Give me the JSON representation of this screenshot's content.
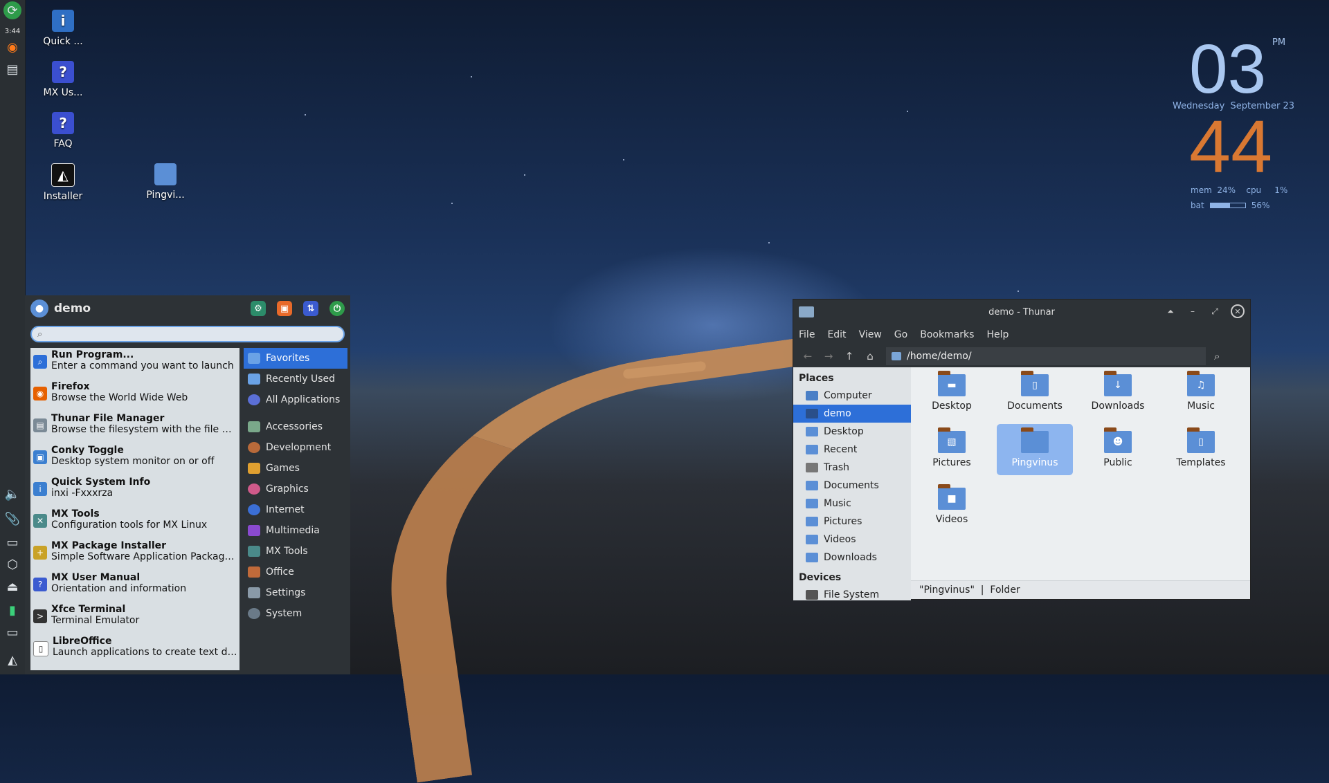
{
  "panel": {
    "clock": "3:44"
  },
  "desktop": {
    "icons": [
      {
        "label": "Quick ...",
        "icon": "info-monitor-icon"
      },
      {
        "label": "MX Us...",
        "icon": "help-icon"
      },
      {
        "label": "FAQ",
        "icon": "help-icon"
      },
      {
        "label": "Installer",
        "icon": "installer-icon"
      },
      {
        "label": "Pingvi...",
        "icon": "folder-icon"
      }
    ]
  },
  "conky": {
    "hour": "03",
    "ampm": "PM",
    "day": "Wednesday",
    "date": "September 23",
    "minute": "44",
    "mem_label": "mem",
    "mem": "24%",
    "cpu_label": "cpu",
    "cpu": "1%",
    "bat_label": "bat",
    "bat": "56%",
    "bat_level": 0.56
  },
  "menu": {
    "user": "demo",
    "search_value": "",
    "apps": [
      {
        "name": "Run Program...",
        "desc": "Enter a command you want to launch",
        "color": "#2d6fd8",
        "glyph": "⌕"
      },
      {
        "name": "Firefox",
        "desc": "Browse the World Wide Web",
        "color": "#e66000",
        "glyph": "◉"
      },
      {
        "name": "Thunar File Manager",
        "desc": "Browse the filesystem with the file ma...",
        "color": "#7b8a96",
        "glyph": "▤"
      },
      {
        "name": "Conky Toggle",
        "desc": "Desktop system monitor on or off",
        "color": "#3b7fd0",
        "glyph": "▣"
      },
      {
        "name": "Quick System Info",
        "desc": "inxi -Fxxxrza",
        "color": "#3b7fd0",
        "glyph": "i"
      },
      {
        "name": "MX Tools",
        "desc": "Configuration tools for MX Linux",
        "color": "#4a8a8a",
        "glyph": "✕"
      },
      {
        "name": "MX Package Installer",
        "desc": "Simple Software Application Package I...",
        "color": "#c9a227",
        "glyph": "+"
      },
      {
        "name": "MX User Manual",
        "desc": "Orientation and information",
        "color": "#3b5bd0",
        "glyph": "?"
      },
      {
        "name": "Xfce Terminal",
        "desc": "Terminal Emulator",
        "color": "#333333",
        "glyph": ">"
      },
      {
        "name": "LibreOffice",
        "desc": "Launch applications to create text doc...",
        "color": "#ffffff",
        "glyph": "▯"
      }
    ],
    "categories_top": [
      "Favorites",
      "Recently Used",
      "All Applications"
    ],
    "categories": [
      "Accessories",
      "Development",
      "Games",
      "Graphics",
      "Internet",
      "Multimedia",
      "MX Tools",
      "Office",
      "Settings",
      "System"
    ]
  },
  "thunar": {
    "title": "demo - Thunar",
    "menus": [
      "File",
      "Edit",
      "View",
      "Go",
      "Bookmarks",
      "Help"
    ],
    "location": "/home/demo/",
    "places_header": "Places",
    "places": [
      "Computer",
      "demo",
      "Desktop",
      "Recent",
      "Trash",
      "Documents",
      "Music",
      "Pictures",
      "Videos",
      "Downloads"
    ],
    "devices_header": "Devices",
    "devices": [
      "File System"
    ],
    "files": [
      {
        "name": "Desktop",
        "glyph": "▬"
      },
      {
        "name": "Documents",
        "glyph": "▯"
      },
      {
        "name": "Downloads",
        "glyph": "↓"
      },
      {
        "name": "Music",
        "glyph": "♫"
      },
      {
        "name": "Pictures",
        "glyph": "▧"
      },
      {
        "name": "Pingvinus",
        "glyph": ""
      },
      {
        "name": "Public",
        "glyph": "☻"
      },
      {
        "name": "Templates",
        "glyph": "▯"
      },
      {
        "name": "Videos",
        "glyph": "■"
      }
    ],
    "status_name": "\"Pingvinus\"",
    "status_sep": "|",
    "status_type": "Folder"
  }
}
